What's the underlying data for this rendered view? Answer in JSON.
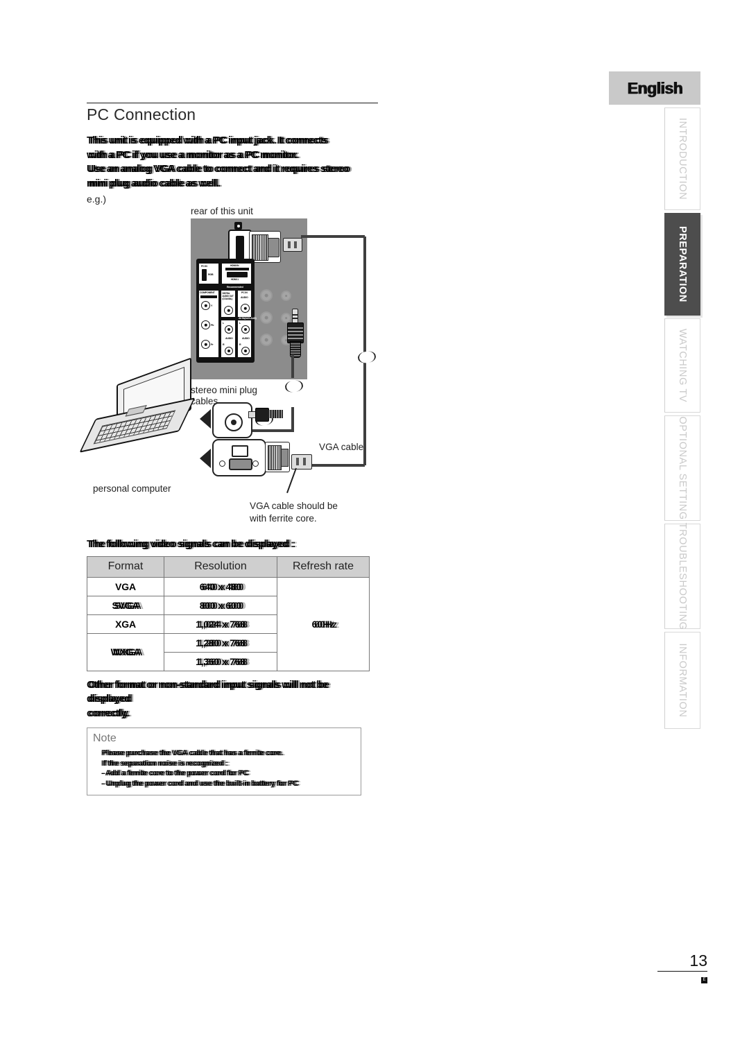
{
  "language_tab": {
    "label": "English"
  },
  "side_tabs": [
    {
      "label": "INTRODUCTION",
      "active": false
    },
    {
      "label": "PREPARATION",
      "active": true
    },
    {
      "label": "WATCHING TV",
      "active": false
    },
    {
      "label": "OPTIONAL SETTING",
      "active": false
    },
    {
      "label": "TROUBLESHOOTING",
      "active": false
    },
    {
      "label": "INFORMATION",
      "active": false
    }
  ],
  "page_title": "PC Connection",
  "intro": {
    "lines": [
      "This unit is equipped with a PC input jack. It connects",
      "with a PC if you use a monitor as a PC monitor.",
      "Use an analog VGA cable to connect and it requires stereo",
      "mini plug audio cable as well."
    ],
    "example_label": "e.g.)"
  },
  "figure": {
    "captions": {
      "rear_of_unit": "rear of this unit",
      "stereo_mini_plug_cables": "stereo mini plug\ncables",
      "vga_cable": "VGA cable",
      "personal_computer": "personal computer",
      "ferrite_note": "VGA cable should be\nwith ferrite core."
    },
    "panel_labels": {
      "pc_in": "PC IN",
      "pc_in_rgb": "RGB",
      "hdmi_in": "HDMI IN",
      "hdmi_sub": "(DVI-HDCP Capable)",
      "hdmi_1": "HDMI 1",
      "hdmi_recommended": "Recommended",
      "component": "COMPONENT",
      "component_sub": "(ANALOG HD Capable)",
      "digital_audio_out": "DIGITAL\nAUDIO OUT\n(COAXIAL)",
      "pc_in_audio_group": "PC IN",
      "pc_in_audio": "AUDIO",
      "av_in": "AV IN(AUX-AUD)",
      "audio": "AUDIO",
      "y": "Y",
      "pb": "Pb",
      "pr": "Pr",
      "left": "L",
      "right": "R"
    }
  },
  "table_intro": "The following video signals can be displayed :",
  "res_table": {
    "headers": [
      "Format",
      "Resolution",
      "Refresh rate"
    ],
    "rows": [
      {
        "format": "VGA",
        "format_smear": false,
        "resolution": "640 x 480",
        "res_smear": true
      },
      {
        "format": "SVGA",
        "format_smear": true,
        "resolution": "800 x 600",
        "res_smear": true
      },
      {
        "format": "XGA",
        "format_smear": false,
        "resolution": "1,024 x 768",
        "res_smear": true
      },
      {
        "format": "WXGA",
        "format_smear": true,
        "resolution": "1,280 x 768",
        "res_smear": true
      },
      {
        "format": "",
        "format_smear": false,
        "resolution": "1,360 x 768",
        "res_smear": true
      }
    ],
    "refresh_rate": "60Hz"
  },
  "after_table": {
    "lines": [
      "Other format or non-standard input signals will not be displayed",
      "correctly."
    ]
  },
  "note": {
    "title": "Note",
    "lines": [
      "Please purchase the VGA cable that has a ferrite core.",
      "If the separation noise is recognized :",
      "- Add a ferrite core to the power cord for PC",
      "- Unplug the power cord and use the built-in battery for PC"
    ]
  },
  "footer": {
    "page_number": "13",
    "mark": "E"
  }
}
